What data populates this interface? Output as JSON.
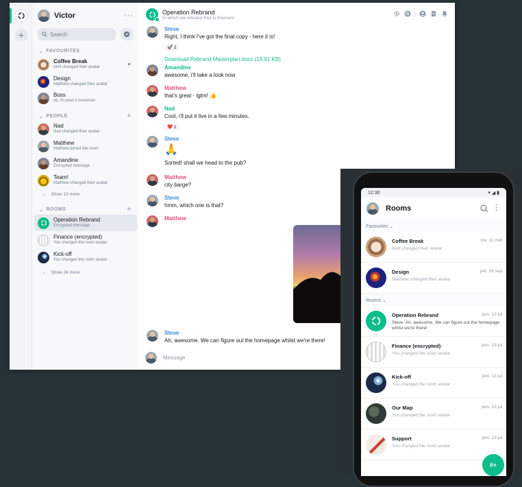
{
  "desktop": {
    "user_name": "Victor",
    "menu_glyph": "···",
    "search_placeholder": "Search",
    "sections": {
      "favourites": "FAVOURITES",
      "people": "PEOPLE",
      "rooms": "ROOMS"
    },
    "favourites": [
      {
        "name": "Coffee Break",
        "sub": "toml changed their avatar"
      },
      {
        "name": "Design",
        "sub": "Matthew changed their avatar"
      },
      {
        "name": "Boss",
        "sub": "ok, i'll send it tomorrow"
      }
    ],
    "people": [
      {
        "name": "Nad",
        "sub": "Nad changed their avatar"
      },
      {
        "name": "Matthew",
        "sub": "Matthew joined the room"
      },
      {
        "name": "Amandine",
        "sub": "Encrypted message"
      },
      {
        "name": "Team!",
        "sub": "Matthew changed their avatar"
      }
    ],
    "people_more": "Show 10 more",
    "rooms": [
      {
        "name": "Operation Rebrand",
        "sub": "Encrypted message"
      },
      {
        "name": "Finance (encrypted)",
        "sub": "You changed the room avatar"
      },
      {
        "name": "Kick-off",
        "sub": "You changed the room avatar"
      }
    ],
    "rooms_more": "Show 24 more",
    "header": {
      "title": "Operation Rebrand",
      "topic": "In which we rebrand Riot to Element"
    },
    "messages": [
      {
        "sender": "Steve",
        "text": "Right, I think I've got the final copy - here it is!",
        "reaction": "🚀 2",
        "file": "Download Rebrand Masterplan.docx (19.91 KB)"
      },
      {
        "sender": "Amandine",
        "text": "awesome, i'll take a look now"
      },
      {
        "sender": "Matthew",
        "text": "that's great - lgtm! 👍"
      },
      {
        "sender": "Nad",
        "text": "Cool, i'll put it live in a few minutes.",
        "reaction": "❤️ 1"
      },
      {
        "sender": "Steve",
        "emoji": "🙏",
        "text": "Sorted! shall we head to the pub?"
      },
      {
        "sender": "Matthew",
        "text": "city barge?"
      },
      {
        "sender": "Steve",
        "text": "hmm, which one is that?"
      },
      {
        "sender": "Matthew"
      },
      {
        "sender": "Steve",
        "text": "Ah, awesome. We can figure out the homepage whilst we're there!"
      }
    ],
    "composer_placeholder": "Message"
  },
  "phone": {
    "time": "12:30",
    "title": "Rooms",
    "sec_favourites": "Favourites",
    "sec_rooms": "Rooms",
    "favourites": [
      {
        "name": "Coffee Break",
        "date": "sre. 11 mar.",
        "sub": "toml changed their avatar"
      },
      {
        "name": "Design",
        "date": "pet. 29 sep.",
        "sub": "Matthew changed their avatar"
      }
    ],
    "rooms": [
      {
        "name": "Operation Rebrand",
        "date": "pon. 13 jul.",
        "sub": "Steve: Ah, awesome. We can figure out the homepage whilst we're there!"
      },
      {
        "name": "Finance (encrypted)",
        "date": "pon. 13 jul.",
        "sub": "You changed the room avatar"
      },
      {
        "name": "Kick-off",
        "date": "pon. 13 jul.",
        "sub": "You changed the room avatar"
      },
      {
        "name": "Our Map",
        "date": "pon. 13 jul.",
        "sub": "You changed the room avatar"
      },
      {
        "name": "Support",
        "date": "pon. 13 jul.",
        "sub": "You changed the room avatar"
      }
    ],
    "fab": "#+"
  },
  "colors": {
    "accent": "#0dbd8b",
    "steve": "#368bd6",
    "matthew": "#e64f7a",
    "backdrop": "#283339"
  }
}
